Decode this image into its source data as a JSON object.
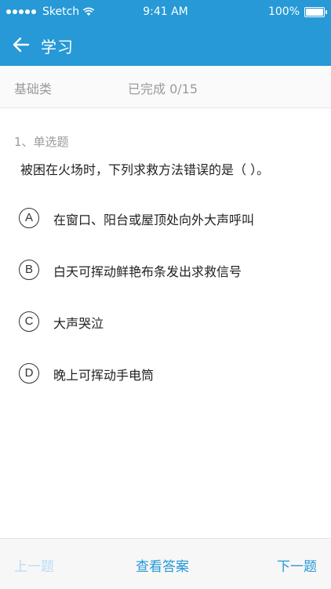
{
  "status_bar": {
    "carrier": "Sketch",
    "time": "9:41 AM",
    "battery": "100%"
  },
  "header": {
    "title": "学习",
    "back_icon": "arrow-left-icon"
  },
  "info_bar": {
    "category": "基础类",
    "progress": "已完成 0/15"
  },
  "question": {
    "type": "1、单选题",
    "text": "被困在火场时，下列求救方法错误的是（ ）。",
    "options": [
      {
        "letter": "A",
        "text": "在窗口、阳台或屋顶处向外大声呼叫"
      },
      {
        "letter": "B",
        "text": "白天可挥动鲜艳布条发出求救信号"
      },
      {
        "letter": "C",
        "text": "大声哭泣"
      },
      {
        "letter": "D",
        "text": "晚上可挥动手电筒"
      }
    ]
  },
  "footer": {
    "prev_label": "上一题",
    "view_answer_label": "查看答案",
    "next_label": "下一题"
  },
  "colors": {
    "accent": "#2699d6",
    "disabled": "#b8ddf2",
    "muted_text": "#9a9a9a"
  }
}
